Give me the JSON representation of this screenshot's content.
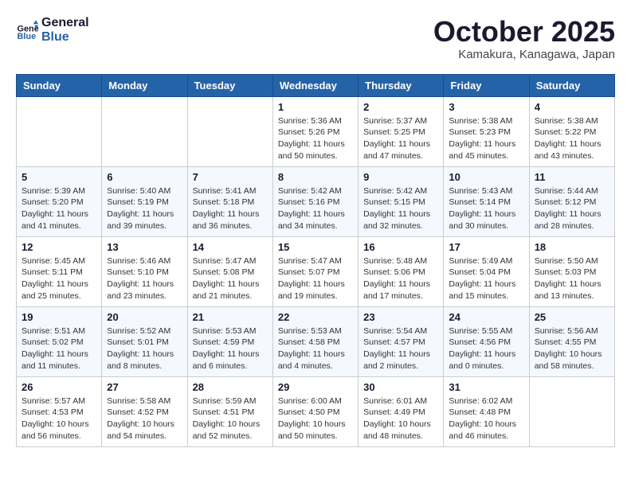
{
  "header": {
    "logo_line1": "General",
    "logo_line2": "Blue",
    "month": "October 2025",
    "location": "Kamakura, Kanagawa, Japan"
  },
  "weekdays": [
    "Sunday",
    "Monday",
    "Tuesday",
    "Wednesday",
    "Thursday",
    "Friday",
    "Saturday"
  ],
  "weeks": [
    [
      {
        "day": "",
        "info": ""
      },
      {
        "day": "",
        "info": ""
      },
      {
        "day": "",
        "info": ""
      },
      {
        "day": "1",
        "info": "Sunrise: 5:36 AM\nSunset: 5:26 PM\nDaylight: 11 hours\nand 50 minutes."
      },
      {
        "day": "2",
        "info": "Sunrise: 5:37 AM\nSunset: 5:25 PM\nDaylight: 11 hours\nand 47 minutes."
      },
      {
        "day": "3",
        "info": "Sunrise: 5:38 AM\nSunset: 5:23 PM\nDaylight: 11 hours\nand 45 minutes."
      },
      {
        "day": "4",
        "info": "Sunrise: 5:38 AM\nSunset: 5:22 PM\nDaylight: 11 hours\nand 43 minutes."
      }
    ],
    [
      {
        "day": "5",
        "info": "Sunrise: 5:39 AM\nSunset: 5:20 PM\nDaylight: 11 hours\nand 41 minutes."
      },
      {
        "day": "6",
        "info": "Sunrise: 5:40 AM\nSunset: 5:19 PM\nDaylight: 11 hours\nand 39 minutes."
      },
      {
        "day": "7",
        "info": "Sunrise: 5:41 AM\nSunset: 5:18 PM\nDaylight: 11 hours\nand 36 minutes."
      },
      {
        "day": "8",
        "info": "Sunrise: 5:42 AM\nSunset: 5:16 PM\nDaylight: 11 hours\nand 34 minutes."
      },
      {
        "day": "9",
        "info": "Sunrise: 5:42 AM\nSunset: 5:15 PM\nDaylight: 11 hours\nand 32 minutes."
      },
      {
        "day": "10",
        "info": "Sunrise: 5:43 AM\nSunset: 5:14 PM\nDaylight: 11 hours\nand 30 minutes."
      },
      {
        "day": "11",
        "info": "Sunrise: 5:44 AM\nSunset: 5:12 PM\nDaylight: 11 hours\nand 28 minutes."
      }
    ],
    [
      {
        "day": "12",
        "info": "Sunrise: 5:45 AM\nSunset: 5:11 PM\nDaylight: 11 hours\nand 25 minutes."
      },
      {
        "day": "13",
        "info": "Sunrise: 5:46 AM\nSunset: 5:10 PM\nDaylight: 11 hours\nand 23 minutes."
      },
      {
        "day": "14",
        "info": "Sunrise: 5:47 AM\nSunset: 5:08 PM\nDaylight: 11 hours\nand 21 minutes."
      },
      {
        "day": "15",
        "info": "Sunrise: 5:47 AM\nSunset: 5:07 PM\nDaylight: 11 hours\nand 19 minutes."
      },
      {
        "day": "16",
        "info": "Sunrise: 5:48 AM\nSunset: 5:06 PM\nDaylight: 11 hours\nand 17 minutes."
      },
      {
        "day": "17",
        "info": "Sunrise: 5:49 AM\nSunset: 5:04 PM\nDaylight: 11 hours\nand 15 minutes."
      },
      {
        "day": "18",
        "info": "Sunrise: 5:50 AM\nSunset: 5:03 PM\nDaylight: 11 hours\nand 13 minutes."
      }
    ],
    [
      {
        "day": "19",
        "info": "Sunrise: 5:51 AM\nSunset: 5:02 PM\nDaylight: 11 hours\nand 11 minutes."
      },
      {
        "day": "20",
        "info": "Sunrise: 5:52 AM\nSunset: 5:01 PM\nDaylight: 11 hours\nand 8 minutes."
      },
      {
        "day": "21",
        "info": "Sunrise: 5:53 AM\nSunset: 4:59 PM\nDaylight: 11 hours\nand 6 minutes."
      },
      {
        "day": "22",
        "info": "Sunrise: 5:53 AM\nSunset: 4:58 PM\nDaylight: 11 hours\nand 4 minutes."
      },
      {
        "day": "23",
        "info": "Sunrise: 5:54 AM\nSunset: 4:57 PM\nDaylight: 11 hours\nand 2 minutes."
      },
      {
        "day": "24",
        "info": "Sunrise: 5:55 AM\nSunset: 4:56 PM\nDaylight: 11 hours\nand 0 minutes."
      },
      {
        "day": "25",
        "info": "Sunrise: 5:56 AM\nSunset: 4:55 PM\nDaylight: 10 hours\nand 58 minutes."
      }
    ],
    [
      {
        "day": "26",
        "info": "Sunrise: 5:57 AM\nSunset: 4:53 PM\nDaylight: 10 hours\nand 56 minutes."
      },
      {
        "day": "27",
        "info": "Sunrise: 5:58 AM\nSunset: 4:52 PM\nDaylight: 10 hours\nand 54 minutes."
      },
      {
        "day": "28",
        "info": "Sunrise: 5:59 AM\nSunset: 4:51 PM\nDaylight: 10 hours\nand 52 minutes."
      },
      {
        "day": "29",
        "info": "Sunrise: 6:00 AM\nSunset: 4:50 PM\nDaylight: 10 hours\nand 50 minutes."
      },
      {
        "day": "30",
        "info": "Sunrise: 6:01 AM\nSunset: 4:49 PM\nDaylight: 10 hours\nand 48 minutes."
      },
      {
        "day": "31",
        "info": "Sunrise: 6:02 AM\nSunset: 4:48 PM\nDaylight: 10 hours\nand 46 minutes."
      },
      {
        "day": "",
        "info": ""
      }
    ]
  ]
}
